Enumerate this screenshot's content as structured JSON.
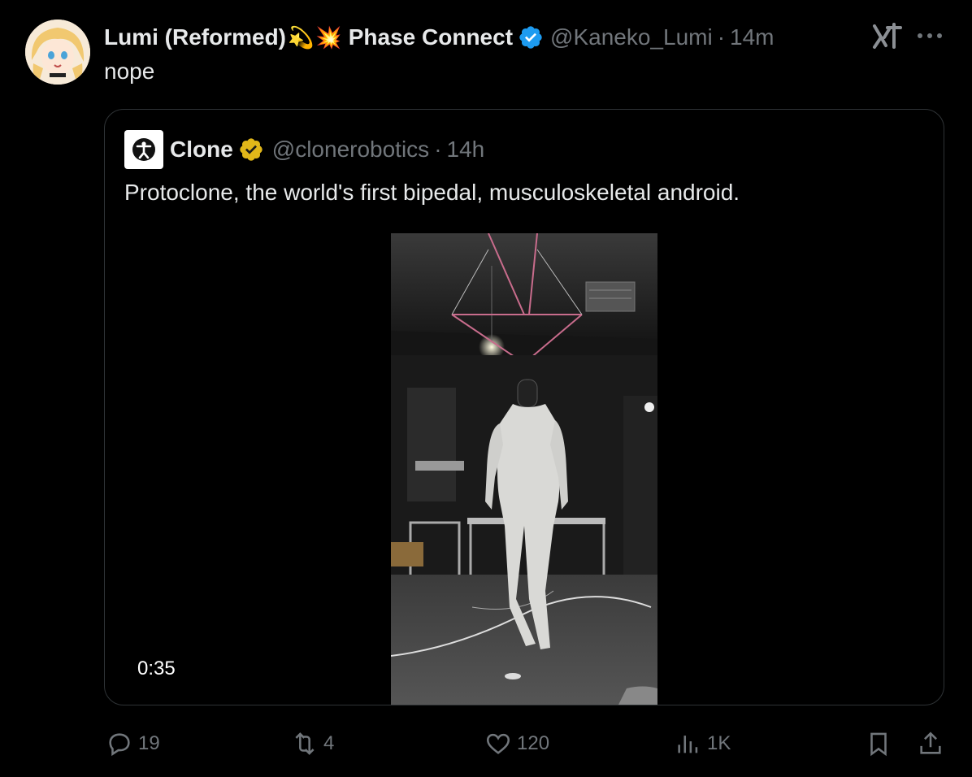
{
  "tweet": {
    "author_name": "Lumi (Reformed)",
    "emoji_1": "💫",
    "emoji_2": "💥",
    "org": "Phase Connect",
    "handle": "@Kaneko_Lumi",
    "separator": "·",
    "time": "14m",
    "text": "nope"
  },
  "quote": {
    "author_name": "Clone",
    "handle": "@clonerobotics",
    "separator": "·",
    "time": "14h",
    "text": "Protoclone, the world's first bipedal, musculoskeletal android.",
    "video_duration": "0:35"
  },
  "actions": {
    "replies": "19",
    "reposts": "4",
    "likes": "120",
    "views": "1K"
  },
  "colors": {
    "background": "#000000",
    "text": "#e7e9ea",
    "muted": "#71767b",
    "blue_verified": "#1d9bf0",
    "gold_verified": "#e2b719",
    "border": "#2f3336"
  },
  "icons": [
    "avatar",
    "verified-badge-icon",
    "grok-icon",
    "more-icon",
    "gold-verified-badge-icon",
    "reply-icon",
    "repost-icon",
    "like-icon",
    "views-icon",
    "bookmark-icon",
    "share-icon"
  ]
}
